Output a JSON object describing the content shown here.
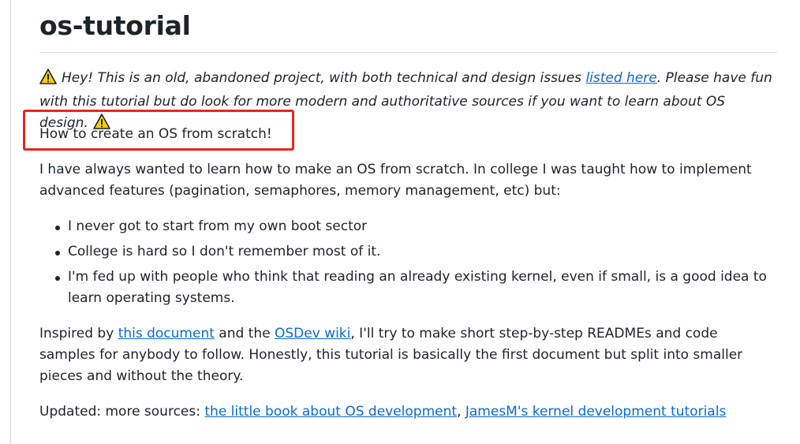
{
  "page": {
    "title": "os-tutorial"
  },
  "warning": {
    "text_before_link": "Hey! This is an old, abandoned project, with both technical and design issues ",
    "link_text": "listed here",
    "text_after_link": ". Please have fun with this tutorial but do look for more modern and authoritative sources if you want to learn about OS design."
  },
  "subtitle": "How to create an OS from scratch!",
  "intro": "I have always wanted to learn how to make an OS from scratch. In college I was taught how to implement advanced features (pagination, semaphores, memory management, etc) but:",
  "bullets": [
    "I never got to start from my own boot sector",
    "College is hard so I don't remember most of it.",
    "I'm fed up with people who think that reading an already existing kernel, even if small, is a good idea to learn operating systems."
  ],
  "inspired": {
    "prefix": "Inspired by ",
    "link1": "this document",
    "middle": " and the ",
    "link2": "OSDev wiki",
    "suffix": ", I'll try to make short step-by-step READMEs and code samples for anybody to follow. Honestly, this tutorial is basically the first document but split into smaller pieces and without the theory."
  },
  "updated": {
    "prefix": "Updated: more sources: ",
    "link1": "the little book about OS development",
    "separator": ", ",
    "link2": "JamesM's kernel development tutorials"
  },
  "icons": {
    "warning": "warning-icon"
  },
  "colors": {
    "link": "#0969da",
    "highlight_box": "#e8261d",
    "warning_fill": "#ffcc00"
  }
}
